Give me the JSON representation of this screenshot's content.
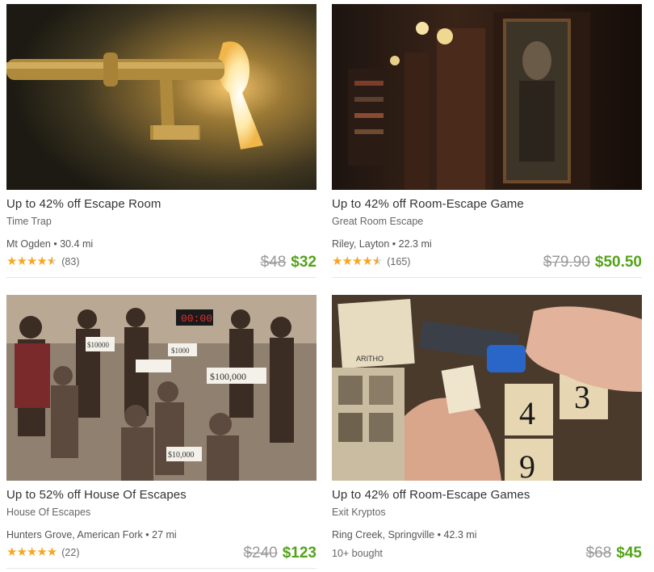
{
  "colors": {
    "accent_price": "#53a318",
    "star": "#f6a623",
    "strike": "#999999"
  },
  "deals": [
    {
      "title": "Up to 42% off Escape Room",
      "merchant": "Time Trap",
      "location": "Mt Ogden • 30.4 mi",
      "rating_stars": 4.5,
      "rating_count": "(83)",
      "old_price": "$48",
      "new_price": "$32",
      "image": "golden key entering a glowing keyhole"
    },
    {
      "title": "Up to 42% off Room-Escape Game",
      "merchant": "Great Room Escape",
      "location": "Riley, Layton • 22.3 mi",
      "rating_stars": 4.5,
      "rating_count": "(165)",
      "old_price": "$79.90",
      "new_price": "$50.50",
      "image": "dim room with bookshelf, wall lamps and framed portrait"
    },
    {
      "title": "Up to 52% off House Of Escapes",
      "merchant": "House Of Escapes",
      "location": "Hunters Grove, American Fork • 27 mi",
      "rating_stars": 5,
      "rating_count": "(22)",
      "old_price": "$240",
      "new_price": "$123",
      "image": "group photo holding money signs",
      "image_texts": [
        "$100,000",
        "$10,000",
        "$1000",
        "$10000",
        "00:00"
      ]
    },
    {
      "title": "Up to 42% off Room-Escape Games",
      "merchant": "Exit Kryptos",
      "location": "Ring Creek, Springville • 42.3 mi",
      "bought": "10+ bought",
      "old_price": "$68",
      "new_price": "$45",
      "image": "hands unlocking a blue padlock over number tiles",
      "image_texts": [
        "ARITHO",
        "4",
        "3",
        "9"
      ]
    }
  ]
}
